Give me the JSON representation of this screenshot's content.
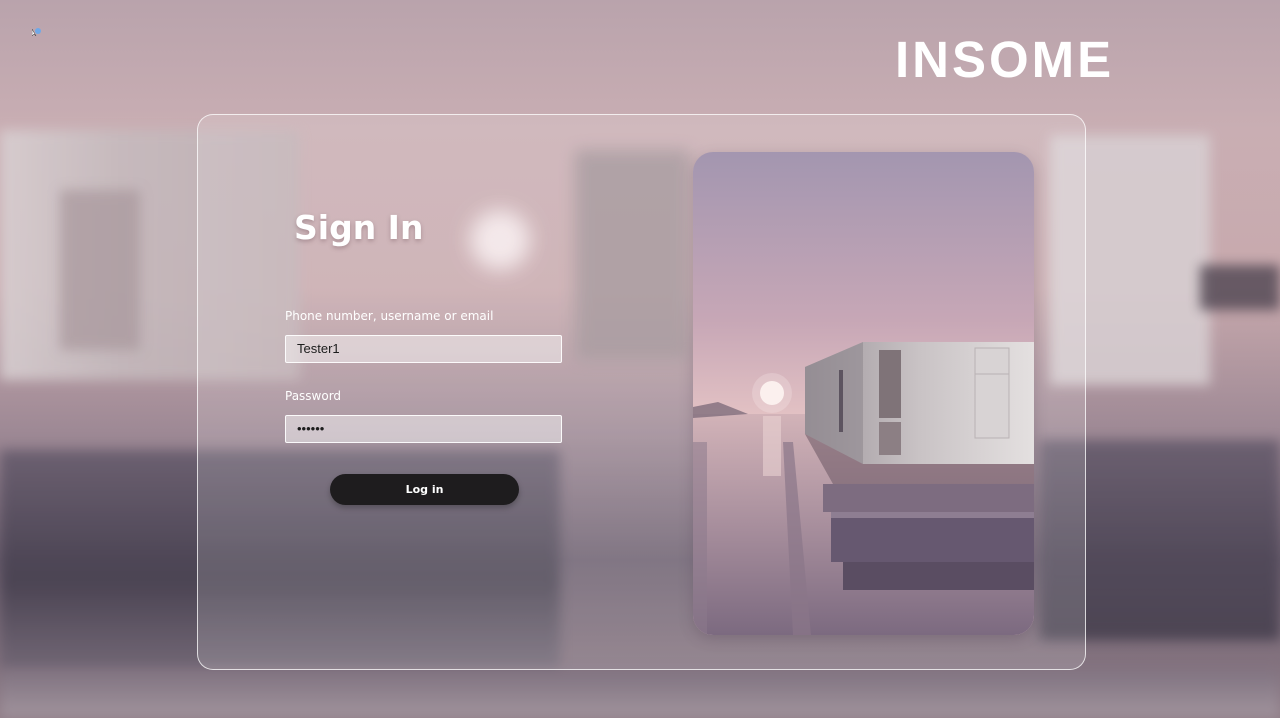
{
  "brand": {
    "name": "INSOME"
  },
  "form": {
    "title": "Sign In",
    "username_label": "Phone number, username or email",
    "username_value": "Tester1",
    "password_label": "Password",
    "password_value": "••••••",
    "login_label": "Log in"
  },
  "image": {
    "subject": "modern-house-on-water-at-dusk"
  },
  "colors": {
    "button": "#1e1c1e",
    "text": "#ffffff",
    "background": "#c8a9ad"
  }
}
